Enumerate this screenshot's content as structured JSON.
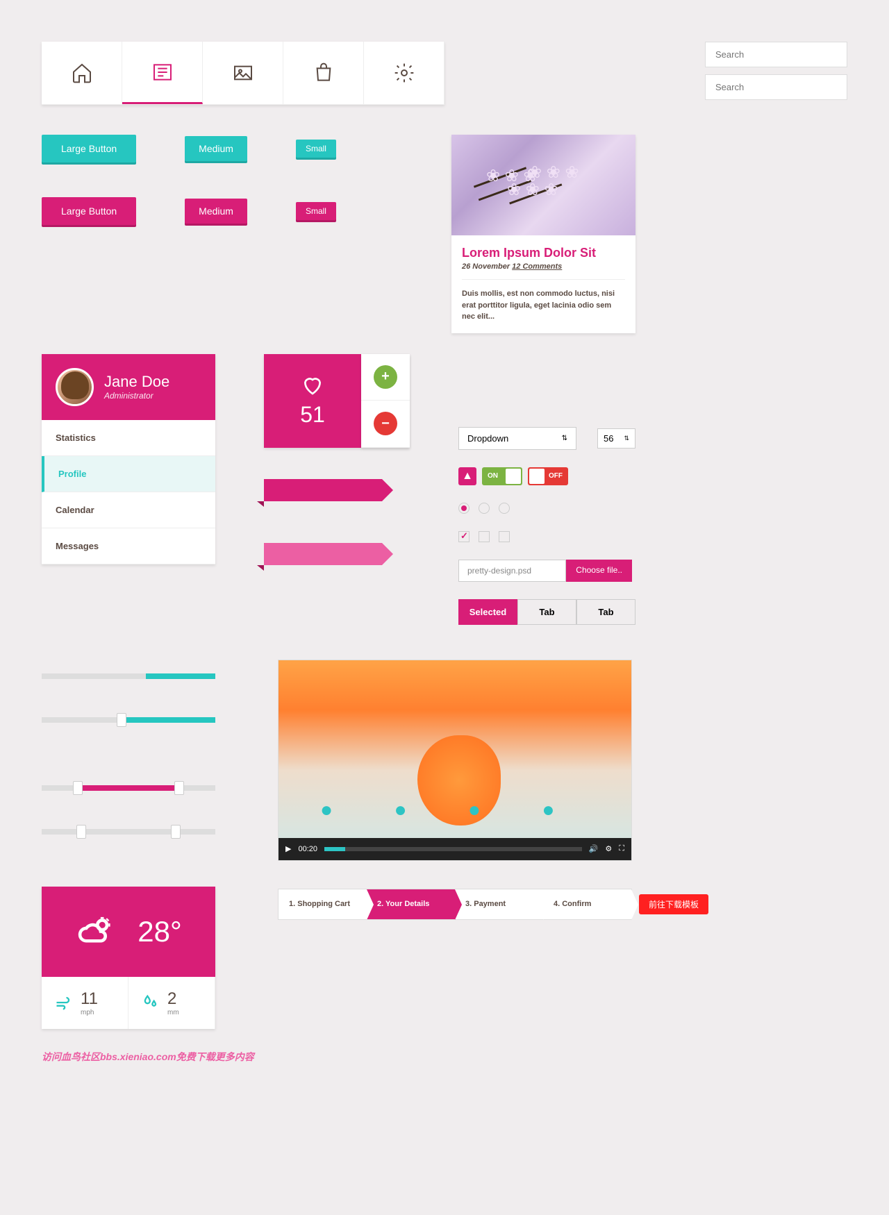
{
  "search": {
    "placeholder": "Search"
  },
  "buttons": {
    "large": "Large Button",
    "medium": "Medium",
    "small": "Small"
  },
  "user": {
    "name": "Jane Doe",
    "role": "Administrator"
  },
  "menu": [
    "Statistics",
    "Profile",
    "Calendar",
    "Messages"
  ],
  "like_count": "51",
  "blog": {
    "title": "Lorem Ipsum Dolor Sit",
    "date": "26 November",
    "comments": "12 Comments",
    "text": "Duis mollis, est non commodo luctus, nisi erat porttitor ligula, eget lacinia odio sem nec elit..."
  },
  "dropdown": "Dropdown",
  "stepper_value": "56",
  "toggle_on": "ON",
  "toggle_off": "OFF",
  "file": {
    "name": "pretty-design.psd",
    "button": "Choose file.."
  },
  "tabs": [
    "Selected",
    "Tab",
    "Tab"
  ],
  "weather": {
    "temp": "28°",
    "wind": "11",
    "wind_unit": "mph",
    "rain": "2",
    "rain_unit": "mm"
  },
  "video_time": "00:20",
  "checkout": [
    "1. Shopping Cart",
    "2. Your Details",
    "3. Payment",
    "4. Confirm"
  ],
  "red_button": "前往下载模板",
  "watermark": "访问血鸟社区bbs.xieniao.com免费下载更多内容"
}
